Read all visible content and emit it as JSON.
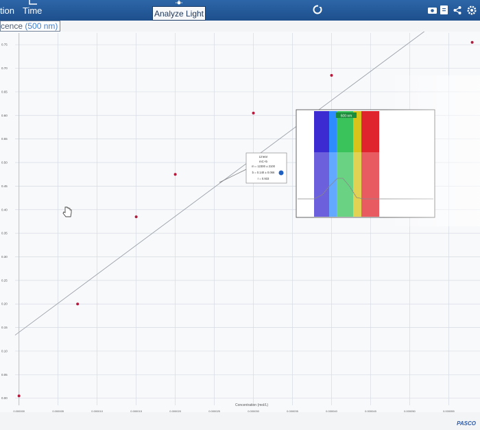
{
  "toolbar": {
    "tab_1": "tion",
    "tab_2": "Time",
    "analyze_label": "Analyze Light",
    "icons": [
      "time-axis-icon",
      "bulb-icon",
      "refresh-icon",
      "camera-icon",
      "file-icon",
      "share-icon",
      "settings-icon"
    ]
  },
  "graph": {
    "y_header_prefix": "cence",
    "y_header_unit": "(500 nm)"
  },
  "fit_box": {
    "title": "Linear",
    "formula": "mC+b",
    "m": "m = 12300 ± 2100",
    "b": "b = 0.140 ± 0.066",
    "r": "r = 0.933"
  },
  "spectrum_inset": {
    "label": "500 nm",
    "colors": [
      "#3b2bd1",
      "#2f8cff",
      "#39c35a",
      "#d8c31b",
      "#f4a21a",
      "#e0242d"
    ]
  },
  "footer": {
    "brand": "PASCO"
  },
  "chart_data": {
    "type": "scatter",
    "xlabel": "Concentration (mol/L)",
    "ylabel": "",
    "x_ticks": [
      "0.000000",
      "0.000005",
      "0.000010",
      "0.000015",
      "0.000020",
      "0.000025",
      "0.000030",
      "0.000035",
      "0.000040",
      "0.000045",
      "0.000050",
      "0.000055"
    ],
    "y_ticks": [
      "0.00",
      "0.05",
      "0.10",
      "0.15",
      "0.20",
      "0.25",
      "0.30",
      "0.35",
      "0.40",
      "0.45",
      "0.50",
      "0.55",
      "0.60",
      "0.65",
      "0.70",
      "0.75"
    ],
    "xlim": [
      -5e-07,
      5.9e-05
    ],
    "ylim": [
      -0.015,
      0.775
    ],
    "x": [
      0.0,
      7.5e-06,
      1.5e-05,
      2e-05,
      3e-05,
      4e-05,
      5.8e-05
    ],
    "y": [
      0.005,
      0.2,
      0.385,
      0.475,
      0.605,
      0.685,
      0.755
    ],
    "fit": {
      "slope": 12300,
      "intercept": 0.14
    }
  }
}
